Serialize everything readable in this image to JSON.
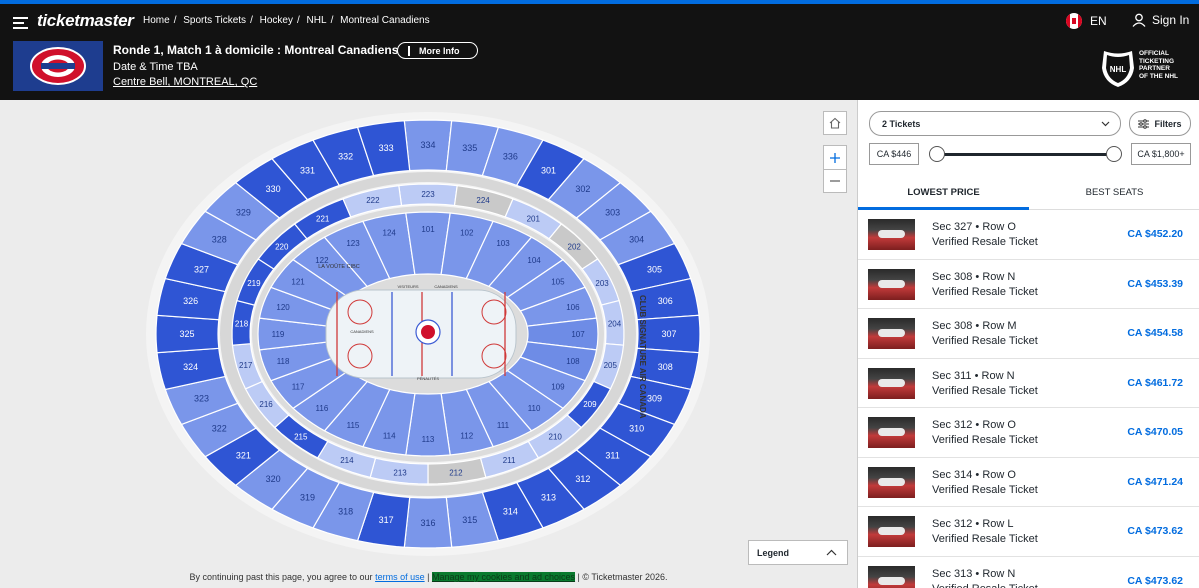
{
  "brand": {
    "logo": "ticketmaster",
    "accent": "#026cdf",
    "header_bg": "#121212"
  },
  "breadcrumb": [
    "Home",
    "Sports Tickets",
    "Hockey",
    "NHL",
    "Montreal Canadiens"
  ],
  "header": {
    "language": "EN",
    "sign_in": "Sign In",
    "event_title": "Ronde 1, Match 1 à domicile : Montreal Canadiens",
    "more_info": "More Info",
    "date": "Date & Time TBA",
    "venue": "Centre Bell, MONTREAL, QC",
    "partner": [
      "OFFICIAL",
      "TICKETING",
      "PARTNER",
      "OF THE NHL"
    ]
  },
  "map": {
    "colors": {
      "available": "#2f55d4",
      "medium": "#7a96ea",
      "light": "#bccbf5",
      "unavailable": "#c9c9c9"
    },
    "upper_ring": [
      "334",
      "335",
      "336",
      "301",
      "302",
      "303",
      "304",
      "305",
      "306",
      "307",
      "308",
      "309",
      "310",
      "311",
      "312",
      "313",
      "314",
      "315",
      "316",
      "317",
      "318",
      "319",
      "320",
      "321",
      "322",
      "323",
      "324",
      "325",
      "326",
      "327",
      "328",
      "329",
      "330",
      "331",
      "332",
      "333"
    ],
    "upper_state": {
      "301": "available",
      "305": "available",
      "306": "available",
      "307": "available",
      "308": "available",
      "309": "available",
      "310": "available",
      "311": "available",
      "312": "available",
      "313": "available",
      "314": "available",
      "317": "available",
      "321": "available",
      "324": "available",
      "325": "available",
      "326": "available",
      "327": "available",
      "330": "available",
      "331": "available",
      "332": "available",
      "333": "available"
    },
    "mid_ring": [
      "223",
      "224",
      "201",
      "202",
      "203",
      "204",
      "205",
      "209",
      "210",
      "211",
      "212",
      "213",
      "214",
      "215",
      "216",
      "217",
      "218",
      "219",
      "220",
      "221",
      "222"
    ],
    "mid_state": {
      "224": "unavailable",
      "202": "unavailable",
      "212": "unavailable",
      "205": "light",
      "209": "available",
      "215": "available",
      "218": "available",
      "219": "available",
      "220": "available",
      "221": "available",
      "222": "light"
    },
    "lower_sections": [
      "122",
      "123",
      "124",
      "101",
      "102",
      "103",
      "104",
      "105",
      "106",
      "107",
      "108",
      "109",
      "110",
      "111",
      "112",
      "113",
      "114",
      "115",
      "116",
      "117",
      "118",
      "119",
      "120",
      "121"
    ],
    "lower_available": [
      "107",
      "108"
    ],
    "labels": {
      "club": "CLUB SIGNATURE AIR CANADA",
      "voute": "LA VOÛTE CIBC",
      "ice_left": "CANADIENS",
      "visitors": "VISITEURS",
      "home": "CANADIENS",
      "penalty": "PÉNALITÉS"
    },
    "legend": "Legend"
  },
  "footer": {
    "prefix": "By continuing past this page, you agree to our",
    "terms": "terms of use",
    "sep": " | ",
    "cookies": "Manage my cookies and ad choices",
    "suffix": " | © Ticketmaster 2026."
  },
  "panel": {
    "quantity": "2 Tickets",
    "filters": "Filters",
    "price_min": "CA $446",
    "price_max": "CA $1,800+",
    "tabs": [
      "LOWEST PRICE",
      "BEST SEATS"
    ],
    "listings": [
      {
        "sec": "Sec 327 • Row O",
        "type": "Verified Resale Ticket",
        "price": "CA $452.20"
      },
      {
        "sec": "Sec 308 • Row N",
        "type": "Verified Resale Ticket",
        "price": "CA $453.39"
      },
      {
        "sec": "Sec 308 • Row M",
        "type": "Verified Resale Ticket",
        "price": "CA $454.58"
      },
      {
        "sec": "Sec 311 • Row N",
        "type": "Verified Resale Ticket",
        "price": "CA $461.72"
      },
      {
        "sec": "Sec 312 • Row O",
        "type": "Verified Resale Ticket",
        "price": "CA $470.05"
      },
      {
        "sec": "Sec 314 • Row O",
        "type": "Verified Resale Ticket",
        "price": "CA $471.24"
      },
      {
        "sec": "Sec 312 • Row L",
        "type": "Verified Resale Ticket",
        "price": "CA $473.62"
      },
      {
        "sec": "Sec 313 • Row N",
        "type": "Verified Resale Ticket",
        "price": "CA $473.62"
      }
    ]
  }
}
